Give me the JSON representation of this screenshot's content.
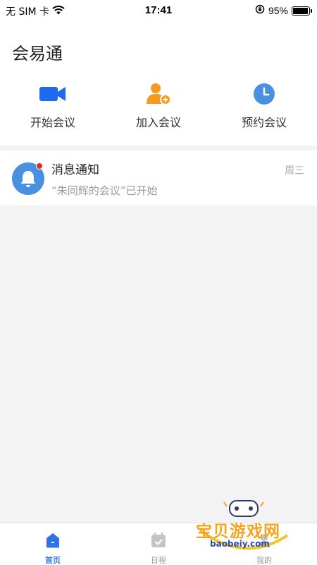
{
  "status_bar": {
    "carrier": "无 SIM 卡",
    "time": "17:41",
    "battery": "95%",
    "battery_level": 0.95
  },
  "app": {
    "title": "会易通"
  },
  "actions": [
    {
      "label": "开始会议",
      "icon": "video-camera-icon",
      "color": "#1f6bf0"
    },
    {
      "label": "加入会议",
      "icon": "add-user-icon",
      "color": "#f59a1f"
    },
    {
      "label": "预约会议",
      "icon": "clock-icon",
      "color": "#4a90e2"
    }
  ],
  "notification": {
    "title": "消息通知",
    "subtitle": "“朱同辉的会议”已开始",
    "day": "周三",
    "icon": "bell-icon",
    "unread": true
  },
  "tabbar": {
    "items": [
      {
        "label": "首页",
        "icon": "home-icon",
        "active": true
      },
      {
        "label": "日程",
        "icon": "calendar-icon",
        "active": false
      },
      {
        "label": "我的",
        "icon": "profile-icon",
        "active": false
      }
    ]
  },
  "watermark": {
    "text": "宝贝游戏网",
    "url": "baobeiy.com"
  },
  "colors": {
    "accent": "#3b7be8",
    "badge": "#e8262b",
    "orange": "#f59a1f"
  }
}
